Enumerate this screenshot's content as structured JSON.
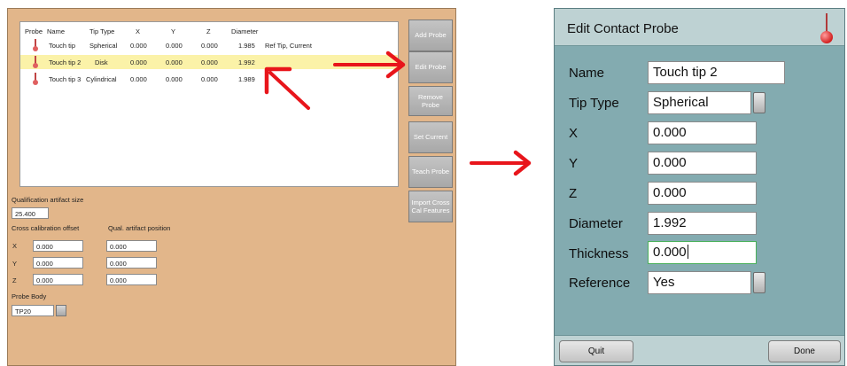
{
  "colors": {
    "left_panel_bg": "#e2b68a",
    "dialog_bg": "#83abb0",
    "dialog_bar_bg": "#bed2d3",
    "selected_row": "#fbf2a8",
    "arrow_red": "#e8151b",
    "focus_green": "#49b05a"
  },
  "probe_table": {
    "headers": [
      "Probe",
      "Name",
      "Tip Type",
      "X",
      "Y",
      "Z",
      "Diameter",
      ""
    ],
    "rows": [
      {
        "name": "Touch tip",
        "tip_type": "Spherical",
        "x": "0.000",
        "y": "0.000",
        "z": "0.000",
        "diameter": "1.985",
        "note": "Ref Tip, Current",
        "selected": false
      },
      {
        "name": "Touch tip 2",
        "tip_type": "Disk",
        "x": "0.000",
        "y": "0.000",
        "z": "0.000",
        "diameter": "1.992",
        "note": "",
        "selected": true
      },
      {
        "name": "Touch tip 3",
        "tip_type": "Cylindrical",
        "x": "0.000",
        "y": "0.000",
        "z": "0.000",
        "diameter": "1.989",
        "note": "",
        "selected": false
      }
    ]
  },
  "side_buttons": {
    "add": "Add Probe",
    "edit": "Edit Probe",
    "remove": "Remove Probe",
    "set_current": "Set Current",
    "teach": "Teach Probe",
    "import": "Import Cross Cal Features"
  },
  "qualification": {
    "size_label": "Qualification artifact size",
    "size_value": "25.400",
    "cross_cal_label": "Cross calibration offset",
    "qual_pos_label": "Qual. artifact position",
    "axis_labels": [
      "X",
      "Y",
      "Z"
    ],
    "cross_cal_values": [
      "0.000",
      "0.000",
      "0.000"
    ],
    "qual_pos_values": [
      "0.000",
      "0.000",
      "0.000"
    ]
  },
  "probe_body": {
    "label": "Probe Body",
    "value": "TP20"
  },
  "dialog": {
    "title": "Edit Contact Probe",
    "fields": {
      "name": {
        "label": "Name",
        "value": "Touch tip 2"
      },
      "tip_type": {
        "label": "Tip Type",
        "value": "Spherical"
      },
      "x": {
        "label": "X",
        "value": "0.000"
      },
      "y": {
        "label": "Y",
        "value": "0.000"
      },
      "z": {
        "label": "Z",
        "value": "0.000"
      },
      "diameter": {
        "label": "Diameter",
        "value": "1.992"
      },
      "thickness": {
        "label": "Thickness",
        "value": "0.000"
      },
      "reference": {
        "label": "Reference",
        "value": "Yes"
      }
    },
    "quit_label": "Quit",
    "done_label": "Done"
  }
}
